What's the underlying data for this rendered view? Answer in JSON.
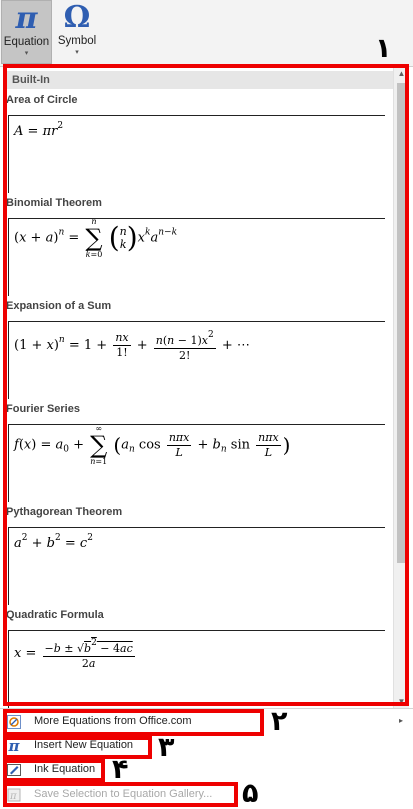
{
  "ribbon": {
    "equation": {
      "icon": "pi-icon",
      "glyph": "π",
      "label": "Equation",
      "caret": "▾"
    },
    "symbol": {
      "icon": "omega-icon",
      "glyph": "Ω",
      "label": "Symbol",
      "caret": "▾"
    }
  },
  "gallery": {
    "header": "Built-In",
    "items": [
      {
        "title": "Area of Circle"
      },
      {
        "title": "Binomial Theorem"
      },
      {
        "title": "Expansion of a Sum"
      },
      {
        "title": "Fourier Series"
      },
      {
        "title": "Pythagorean Theorem"
      },
      {
        "title": "Quadratic Formula"
      }
    ],
    "scrollbar": {
      "up": "▲",
      "down": "▼"
    }
  },
  "menu": {
    "more": {
      "icon": "office-equation-icon",
      "label": "More Equations from Office.com",
      "arrow": "▸"
    },
    "insert": {
      "icon": "pi-icon",
      "glyph": "π",
      "label": "Insert New Equation"
    },
    "ink": {
      "icon": "ink-pen-icon",
      "label": "Ink Equation"
    },
    "save": {
      "icon": "save-equation-icon",
      "label": "Save Selection to Equation Gallery..."
    }
  },
  "annotations": [
    "۱",
    "۲",
    "۳",
    "۴",
    "۵"
  ],
  "colors": {
    "accent": "#2f5eb1",
    "annotation": "#ee0000"
  }
}
